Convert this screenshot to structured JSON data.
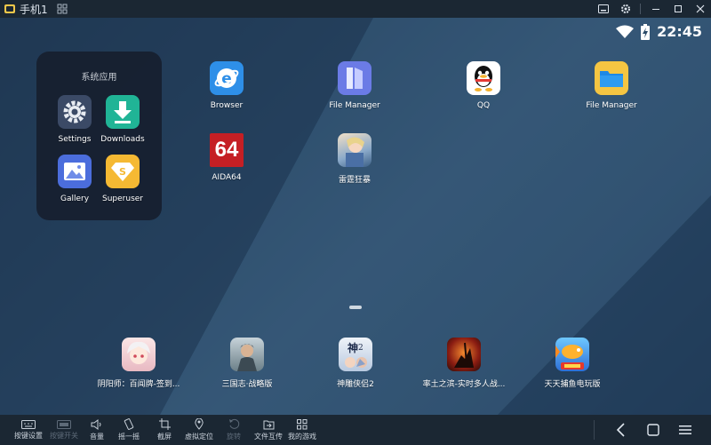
{
  "window": {
    "title": "手机1",
    "icons": [
      "phone-app-icon",
      "grid-icon",
      "keyboard-icon",
      "gear-icon",
      "minimize-icon",
      "maximize-icon",
      "close-icon"
    ]
  },
  "status": {
    "time": "22:45"
  },
  "folder": {
    "title": "系统应用",
    "apps": [
      {
        "label": "Settings",
        "icon": "settings-icon"
      },
      {
        "label": "Downloads",
        "icon": "downloads-icon"
      },
      {
        "label": "Gallery",
        "icon": "gallery-icon"
      },
      {
        "label": "Superuser",
        "icon": "superuser-icon"
      }
    ]
  },
  "desktop_apps": [
    {
      "label": "Browser",
      "icon": "browser-icon"
    },
    {
      "label": "File Manager",
      "icon": "file-manager-icon"
    },
    {
      "label": "QQ",
      "icon": "qq-icon"
    },
    {
      "label": "File Manager",
      "icon": "folder-icon"
    },
    {
      "label": "AIDA64",
      "icon": "aida64-icon"
    },
    {
      "label": "雷霆狂暴",
      "icon": "game-icon"
    }
  ],
  "dock_apps": [
    {
      "label": "阴阳师：百闻牌-签到...",
      "icon": "game-icon"
    },
    {
      "label": "三国志·战略版",
      "icon": "game-icon"
    },
    {
      "label": "神雕侠侣2",
      "icon": "game-icon"
    },
    {
      "label": "率土之滨-实时多人战...",
      "icon": "game-icon"
    },
    {
      "label": "天天捕鱼电玩版",
      "icon": "game-icon"
    }
  ],
  "aida_text": "64",
  "toolbar": {
    "items": [
      {
        "label": "按键设置",
        "icon": "keyboard-icon"
      },
      {
        "label": "按键开关",
        "icon": "keyboard-toggle-icon",
        "disabled": true
      },
      {
        "label": "音量",
        "icon": "volume-icon"
      },
      {
        "label": "摇一摇",
        "icon": "shake-icon"
      },
      {
        "label": "截屏",
        "icon": "crop-icon"
      },
      {
        "label": "虚拟定位",
        "icon": "location-icon"
      },
      {
        "label": "旋转",
        "icon": "rotate-icon",
        "disabled": true
      },
      {
        "label": "文件互传",
        "icon": "file-transfer-icon"
      },
      {
        "label": "我的游戏",
        "icon": "apps-grid-icon"
      }
    ],
    "nav": [
      "back-icon",
      "home-icon",
      "menu-icon"
    ]
  },
  "colors": {
    "chrome": "#1b2733",
    "wallpaper": "#2a4a68",
    "folder_bg": "#161e2c"
  }
}
